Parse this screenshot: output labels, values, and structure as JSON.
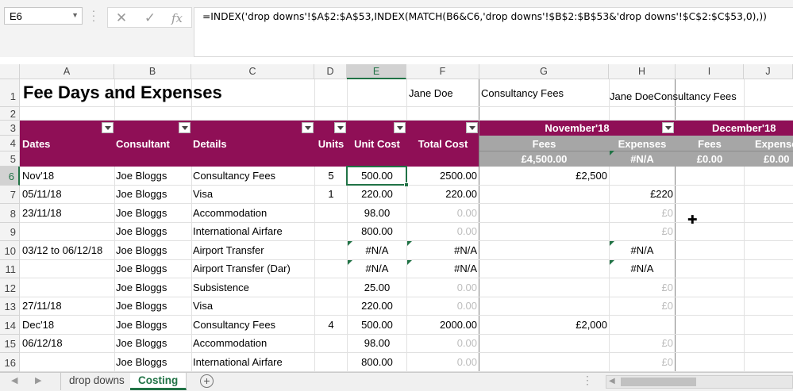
{
  "namebox": "E6",
  "formula": "=INDEX('drop downs'!$A$2:$A$53,INDEX(MATCH(B6&C6,'drop downs'!$B$2:$B$53&'drop downs'!$C$2:$C$53,0),))",
  "formula_buttons": {
    "cancel": "✕",
    "enter": "✓",
    "function": "fx"
  },
  "columns": [
    "A",
    "B",
    "C",
    "D",
    "E",
    "F",
    "G",
    "H",
    "I",
    "J"
  ],
  "selected_column": "E",
  "rows": [
    "1",
    "2",
    "3",
    "4",
    "5",
    "6",
    "7",
    "8",
    "9",
    "10",
    "11",
    "12",
    "13",
    "14",
    "15",
    "16"
  ],
  "selected_row": "6",
  "sheet": {
    "title": "Fee Days and Expenses",
    "f1": "Jane Doe",
    "g1": "Consultancy Fees",
    "h1": "Jane DoeConsultancy Fees",
    "headers": {
      "dates": "Dates",
      "consultant": "Consultant",
      "details": "Details",
      "units": "Units",
      "unit_cost": "Unit Cost",
      "total_cost": "Total Cost"
    },
    "month1": "November'18",
    "month2": "December'18",
    "fees": "Fees",
    "expenses": "Expenses",
    "fees_total_1": "£4,500.00",
    "exp_total_1": "#N/A",
    "fees_total_2": "£0.00",
    "exp_total_2": "£0.00",
    "data": [
      {
        "a": "Nov'18",
        "b": "Joe Bloggs",
        "c": "Consultancy Fees",
        "d": "5",
        "e": "500.00",
        "f": "2500.00",
        "g": "£2,500",
        "h": ""
      },
      {
        "a": "05/11/18",
        "b": "Joe Bloggs",
        "c": "Visa",
        "d": "1",
        "e": "220.00",
        "f": "220.00",
        "g": "",
        "h": "£220"
      },
      {
        "a": "23/11/18",
        "b": "Joe Bloggs",
        "c": "Accommodation",
        "d": "",
        "e": "98.00",
        "f": "0.00",
        "g": "",
        "h": "£0"
      },
      {
        "a": "",
        "b": "Joe Bloggs",
        "c": "International Airfare",
        "d": "",
        "e": "800.00",
        "f": "0.00",
        "g": "",
        "h": "£0"
      },
      {
        "a": "03/12 to 06/12/18",
        "b": "Joe Bloggs",
        "c": "Airport Transfer",
        "d": "",
        "e": "#N/A",
        "f": "#N/A",
        "g": "",
        "h": "#N/A"
      },
      {
        "a": "",
        "b": "Joe Bloggs",
        "c": "Airport Transfer (Dar)",
        "d": "",
        "e": "#N/A",
        "f": "#N/A",
        "g": "",
        "h": "#N/A"
      },
      {
        "a": "",
        "b": "Joe Bloggs",
        "c": "Subsistence",
        "d": "",
        "e": "25.00",
        "f": "0.00",
        "g": "",
        "h": "£0"
      },
      {
        "a": "27/11/18",
        "b": "Joe Bloggs",
        "c": "Visa",
        "d": "",
        "e": "220.00",
        "f": "0.00",
        "g": "",
        "h": "£0"
      },
      {
        "a": "Dec'18",
        "b": "Joe Bloggs",
        "c": "Consultancy Fees",
        "d": "4",
        "e": "500.00",
        "f": "2000.00",
        "g": "£2,000",
        "h": ""
      },
      {
        "a": "06/12/18",
        "b": "Joe Bloggs",
        "c": "Accommodation",
        "d": "",
        "e": "98.00",
        "f": "0.00",
        "g": "",
        "h": "£0"
      },
      {
        "a": "",
        "b": "Joe Bloggs",
        "c": "International Airfare",
        "d": "",
        "e": "800.00",
        "f": "0.00",
        "g": "",
        "h": "£0"
      }
    ]
  },
  "tabs": {
    "sheet1": "drop downs",
    "sheet2": "Costing",
    "add": "+"
  },
  "colors": {
    "band": "#8f0f56",
    "gray_band": "#a6a6a6",
    "accent": "#217346"
  }
}
